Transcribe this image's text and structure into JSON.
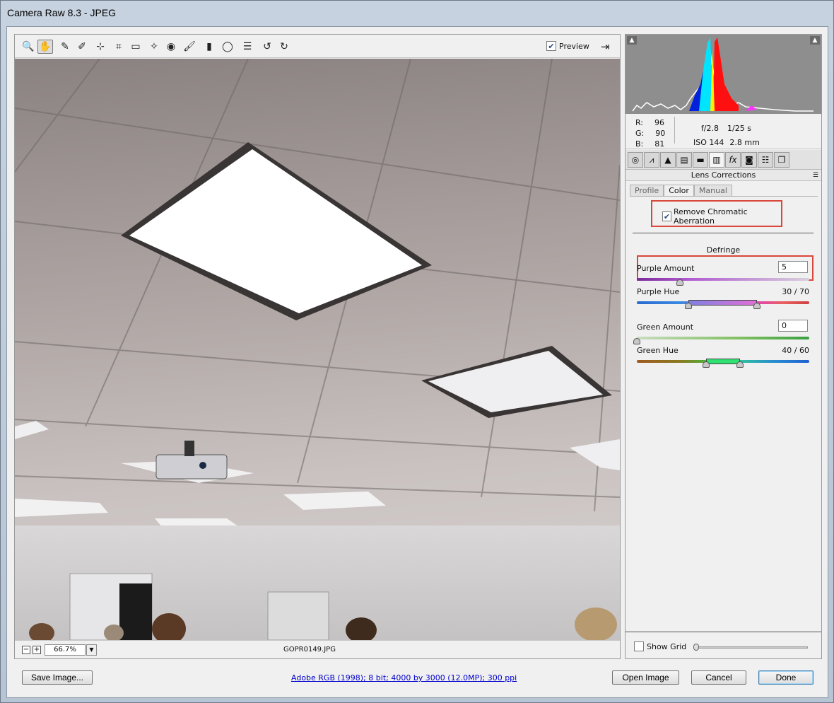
{
  "window": {
    "title": "Camera Raw 8.3  -  JPEG"
  },
  "toolbar": {
    "tools": [
      {
        "name": "zoom-tool",
        "glyph": "🔍"
      },
      {
        "name": "hand-tool",
        "glyph": "✋"
      },
      {
        "name": "white-balance-tool",
        "glyph": "✎"
      },
      {
        "name": "color-sampler-tool",
        "glyph": "✐"
      },
      {
        "name": "targeted-adjustment-tool",
        "glyph": "⊹"
      },
      {
        "name": "crop-tool",
        "glyph": "⌗"
      },
      {
        "name": "straighten-tool",
        "glyph": "▭"
      },
      {
        "name": "spot-removal-tool",
        "glyph": "✧"
      },
      {
        "name": "red-eye-tool",
        "glyph": "◉"
      },
      {
        "name": "adjustment-brush-tool",
        "glyph": "🖌"
      },
      {
        "name": "graduated-filter-tool",
        "glyph": "▮"
      },
      {
        "name": "radial-filter-tool",
        "glyph": "◯"
      },
      {
        "name": "preferences-tool",
        "glyph": "☰"
      },
      {
        "name": "rotate-left-tool",
        "glyph": "↺"
      },
      {
        "name": "rotate-right-tool",
        "glyph": "↻"
      }
    ],
    "preview_label": "Preview",
    "preview_checked": true
  },
  "status": {
    "zoom": "66.7%",
    "filename": "GOPR0149.JPG"
  },
  "readout": {
    "r_label": "R:",
    "r": "96",
    "g_label": "G:",
    "g": "90",
    "b_label": "B:",
    "b": "81",
    "aperture": "f/2.8",
    "shutter": "1/25 s",
    "iso": "ISO 144",
    "focal": "2.8 mm"
  },
  "panel": {
    "section_title": "Lens Corrections",
    "subtabs": [
      "Profile",
      "Color",
      "Manual"
    ],
    "active_subtab": "Color",
    "remove_ca_label": "Remove Chromatic Aberration",
    "remove_ca_checked": true,
    "defringe_label": "Defringe",
    "purple_amount_label": "Purple Amount",
    "purple_amount_value": "5",
    "purple_amount_fraction": 0.25,
    "purple_hue_label": "Purple Hue",
    "purple_hue_value": "30 / 70",
    "green_amount_label": "Green Amount",
    "green_amount_value": "0",
    "green_hue_label": "Green Hue",
    "green_hue_value": "40 / 60",
    "show_grid_label": "Show Grid"
  },
  "buttons": {
    "save": "Save Image...",
    "open": "Open Image",
    "cancel": "Cancel",
    "done": "Done"
  },
  "workflow_link": "Adobe RGB (1998); 8 bit; 4000 by 3000 (12.0MP); 300 ppi",
  "colors": {
    "highlight_box": "#d9473a",
    "link": "#0000cc"
  }
}
